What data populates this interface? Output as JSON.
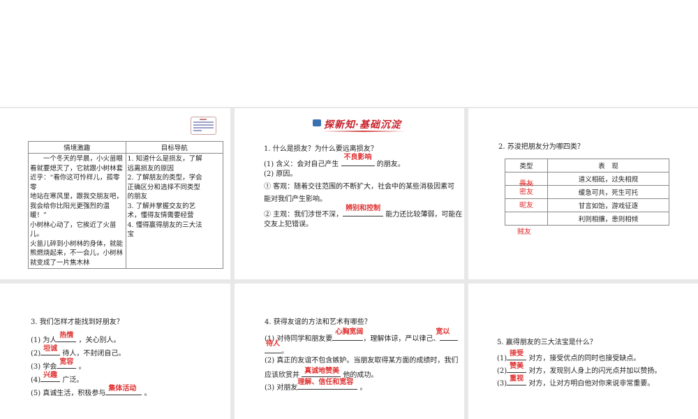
{
  "slide1": {
    "table_headers": [
      "情境激趣",
      "目标导航"
    ],
    "story_lines": [
      "一个冬天的早晨，小火苗眼",
      "看就要熄灭了，它就跟小树林套",
      "近乎：“看你这可怜样儿，孤零零",
      "地站在寒风里，跟我交朋友吧，",
      "我会给你比阳光更强烈的温暖！”",
      "小树林心动了，它挨近了火苗儿。",
      "火苗儿碎到小树林的身体，就能",
      "熊燃烧起来，不一会儿，小树林",
      "就变成了一片焦木林"
    ],
    "goal_lines": [
      "1. 知道什么是损友，了解",
      "远离损友的原因",
      "2. 了解朋友的类型，学会",
      "正确区分和选择不同类型",
      "的朋友",
      "3. 了解并掌握交友的艺",
      "术，懂得友情需要经营",
      "4. 懂得赢得朋友的三大法",
      "宝"
    ]
  },
  "slide2": {
    "banner": "探新知·基础沉淀",
    "q1": "1. 什么是损友？为什么要远离损友？",
    "l1a": "(1) 含义：会对自己产生",
    "a1": "不良影响",
    "l1b": "的朋友。",
    "l2": "(2) 原因。",
    "l3a": "① 客观：随着交往范围的不断扩大，社会中的某些消极因素可",
    "l3b": "能对我们产生影响。",
    "l4a": "② 主观：我们涉世不深，",
    "a2": "辨别和控制",
    "l4b": "能力还比较薄弱，可能在",
    "l4c": "交友上犯错误。"
  },
  "slide3": {
    "q2": "2. 苏浚把朋友分为哪四类？",
    "headers": [
      "类型",
      "表　现"
    ],
    "rows": [
      {
        "type": "畏友",
        "desc": "道义相砥，过失相规"
      },
      {
        "type": "密友",
        "desc": "缓急可共，死生可托"
      },
      {
        "type": "昵友",
        "desc": "甘言如饴，游戏征逐"
      },
      {
        "type": "贼友",
        "desc": "利则相攘，患则相倾"
      }
    ]
  },
  "slide4": {
    "q3": "3. 我们怎样才能找到好朋友？",
    "items": [
      {
        "pre": "(1) 为人",
        "ans": "热情",
        "post": "，关心别人。"
      },
      {
        "pre": "(2)",
        "ans": "坦诚",
        "post": "待人，不封闭自己。"
      },
      {
        "pre": "(3) 学会",
        "ans": "宽容",
        "post": "。"
      },
      {
        "pre": "(4)",
        "ans": "兴趣",
        "post": "广泛。"
      },
      {
        "pre": "(5) 真诚生活，积极参与",
        "ans": "集体活动",
        "post": "。"
      }
    ]
  },
  "slide5": {
    "q4": "4. 获得友谊的方法和艺术有哪些？",
    "l1a": "(1) 对待同学和朋友要",
    "a1": "心胸宽阔",
    "l1b": "，理解体谅，严以律己、",
    "a2a": "宽以",
    "a2b": "待人",
    "l1c": "。",
    "l2a": "(2) 真正的友谊不包含嫉妒。当朋友取得某方面的成绩时，我们",
    "l2b": "应该欣赏并",
    "a3": "真诚地赞美",
    "l2c": "他的成功。",
    "l3a": "(3) 对朋友",
    "a4": "理解、信任和宽容",
    "l3b": "。"
  },
  "slide6": {
    "q5": "5. 赢得朋友的三大法宝是什么？",
    "items": [
      {
        "pre": "(1)",
        "ans": "接受",
        "post": "对方，接受优点的同时也接受缺点。"
      },
      {
        "pre": "(2)",
        "ans": "赞美",
        "post": "对方，发现别人身上的闪光点并加以赞扬。"
      },
      {
        "pre": "(3)",
        "ans": "重视",
        "post": "对方，让对方明白他对你来说非常重要。"
      }
    ]
  }
}
